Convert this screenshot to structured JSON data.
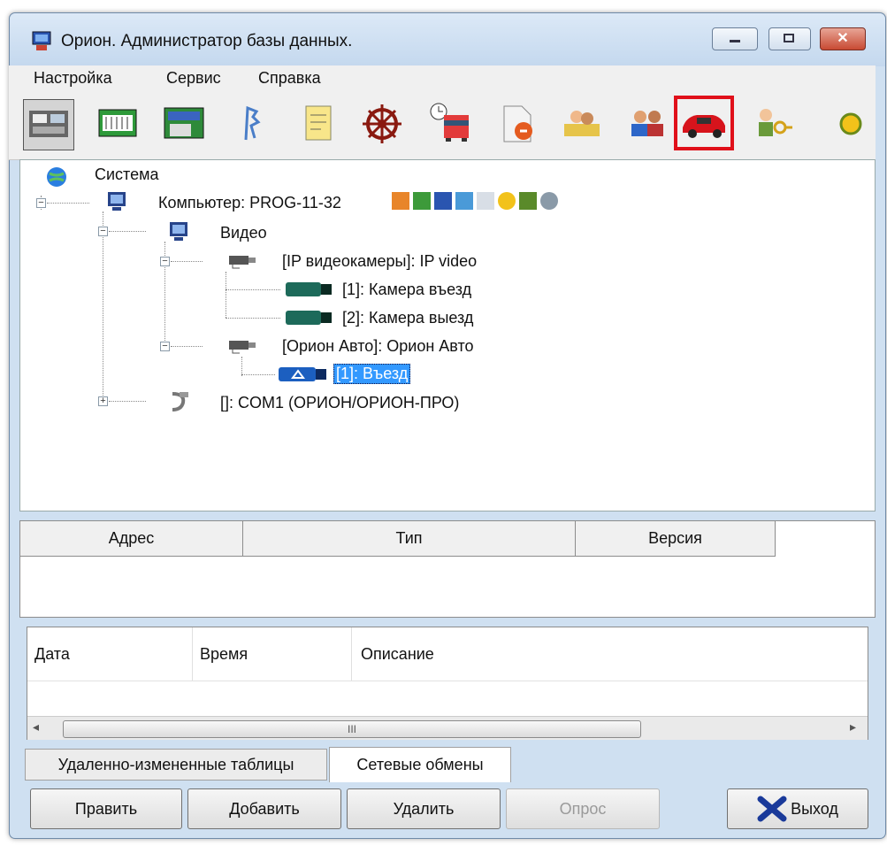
{
  "window": {
    "title": "Орион. Администратор базы данных."
  },
  "menu": [
    "Настройка",
    "Сервис",
    "Справка"
  ],
  "toolbar": {
    "icons": [
      "devices-icon",
      "modules-icon",
      "panels-icon",
      "map-icon",
      "notes-icon",
      "wheel-icon",
      "schedule-icon",
      "document-icon",
      "users-icon",
      "people-icon",
      "car-icon",
      "keys-icon",
      "sun-icon"
    ],
    "selected_icon": "car-icon",
    "highlight_color": "#e0101a"
  },
  "tree": {
    "root": "Система",
    "computer": "Компьютер: PROG-11-32",
    "video": "Видео",
    "ip_group": "[IP видеокамеры]: IP video",
    "cam1": "[1]: Камера въезд",
    "cam2": "[2]: Камера выезд",
    "orion_group": "[Орион Авто]: Орион Авто",
    "orion_entry": "[1]: Въезд",
    "com": "[]: COM1 (ОРИОН/ОРИОН-ПРО)"
  },
  "grid_top": {
    "headers": [
      "Адрес",
      "Тип",
      "Версия"
    ]
  },
  "grid_bottom": {
    "headers": [
      "Дата",
      "Время",
      "Описание"
    ],
    "scroll_thumb": "III"
  },
  "tabs": [
    "Удаленно-измененные таблицы",
    "Сетевые обмены"
  ],
  "buttons": {
    "edit": "Править",
    "add": "Добавить",
    "delete": "Удалить",
    "poll": "Опрос",
    "exit": "Выход"
  }
}
